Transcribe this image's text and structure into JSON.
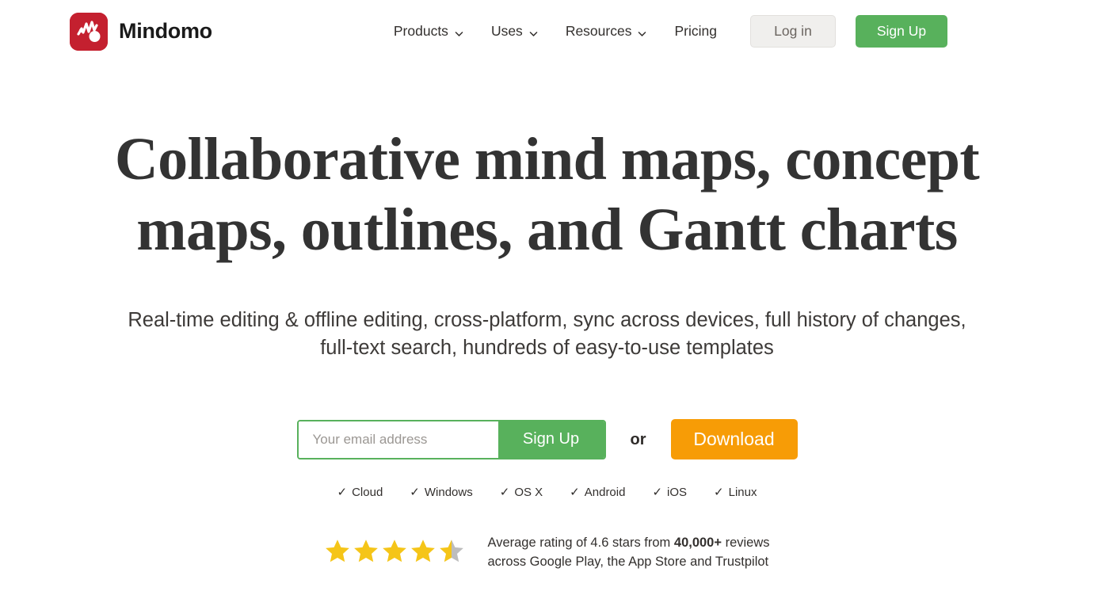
{
  "brand": {
    "name": "Mindomo",
    "logo_icon": "mindomo-logo-icon",
    "logo_color": "#c4202f"
  },
  "header": {
    "nav": [
      {
        "label": "Products",
        "has_dropdown": true,
        "icon": "chevron-down-icon"
      },
      {
        "label": "Uses",
        "has_dropdown": true,
        "icon": "chevron-down-icon"
      },
      {
        "label": "Resources",
        "has_dropdown": true,
        "icon": "chevron-down-icon"
      },
      {
        "label": "Pricing",
        "has_dropdown": false,
        "icon": ""
      }
    ],
    "login_label": "Log in",
    "signup_label": "Sign Up",
    "login_bg": "#f0efed",
    "signup_bg": "#58b15c"
  },
  "hero": {
    "title_line1": "Collaborative mind maps, concept",
    "title_line2": "maps, outlines, and Gantt charts",
    "subtitle_line1": "Real-time editing & offline editing, cross-platform, sync across devices, full history of",
    "subtitle_line2": "changes, full-text search, hundreds of easy-to-use templates"
  },
  "signup": {
    "email_placeholder": "Your email address",
    "email_value": "",
    "signup_label": "Sign Up",
    "or_label": "or",
    "download_label": "Download",
    "signup_color": "#58b15c",
    "download_color": "#f79c06"
  },
  "platforms": [
    {
      "check": "✓",
      "label": "Cloud"
    },
    {
      "check": "✓",
      "label": "Windows"
    },
    {
      "check": "✓",
      "label": "OS X"
    },
    {
      "check": "✓",
      "label": "Android"
    },
    {
      "check": "✓",
      "label": "iOS"
    },
    {
      "check": "✓",
      "label": "Linux"
    }
  ],
  "rating": {
    "stars_total": 5,
    "stars_filled": 4.5,
    "star_color": "#f5c518",
    "star_empty_color": "#bdbdbd",
    "text_part1": "Average rating of 4.6 stars from ",
    "text_bold": "40,000+",
    "text_part2": " reviews",
    "text_line2": "across Google Play, the App Store and Trustpilot"
  }
}
